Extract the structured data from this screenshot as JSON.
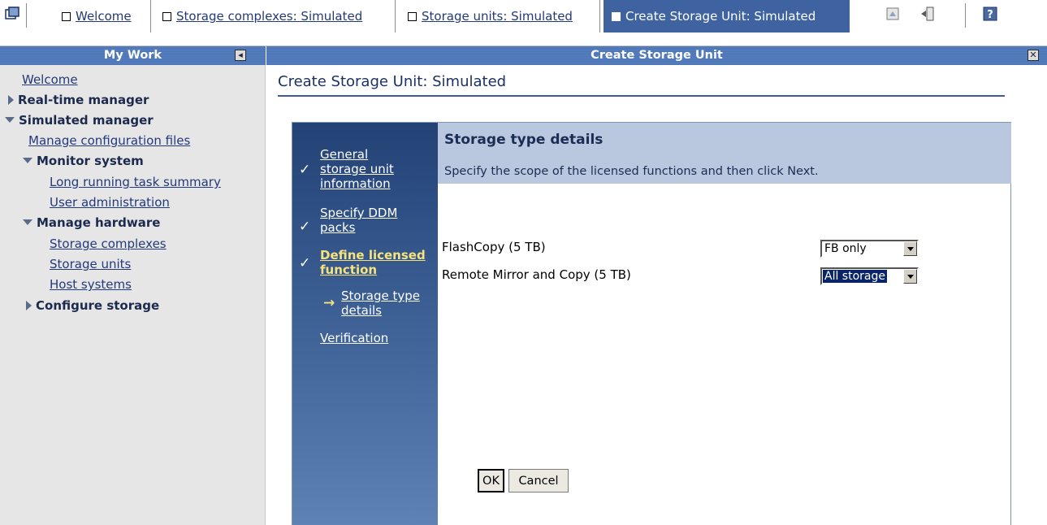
{
  "tabs": [
    {
      "label": "Welcome"
    },
    {
      "label": "Storage complexes: Simulated"
    },
    {
      "label": "Storage units: Simulated"
    },
    {
      "label": "Create Storage Unit: Simulated"
    }
  ],
  "titlebars": {
    "left": "My Work",
    "right": "Create Storage Unit"
  },
  "nav": {
    "welcome": "Welcome",
    "realtime": "Real-time manager",
    "simulated": "Simulated manager",
    "manage_config": "Manage configuration files",
    "monitor": "Monitor system",
    "long_running": "Long running task summary",
    "user_admin": "User administration",
    "manage_hw": "Manage hardware",
    "storage_complexes": "Storage complexes",
    "storage_units": "Storage units",
    "host_systems": "Host systems",
    "configure_storage": "Configure storage"
  },
  "page_title": "Create Storage Unit: Simulated",
  "wizard": {
    "steps": {
      "s1a": "General",
      "s1b": "storage unit",
      "s1c": "information",
      "s2a": "Specify DDM",
      "s2b": "packs",
      "s3a": "Define licensed",
      "s3b": "function",
      "s4a": "Storage type",
      "s4b": "details",
      "s5": "Verification"
    },
    "heading": "Storage type details",
    "instruction": "Specify the scope of the licensed functions and then click Next.",
    "fields": {
      "flashcopy_label": "FlashCopy (5 TB)",
      "flashcopy_value": "FB only",
      "remote_label": "Remote Mirror and Copy (5 TB)",
      "remote_value": "All storage"
    },
    "ok": "OK",
    "cancel": "Cancel"
  }
}
